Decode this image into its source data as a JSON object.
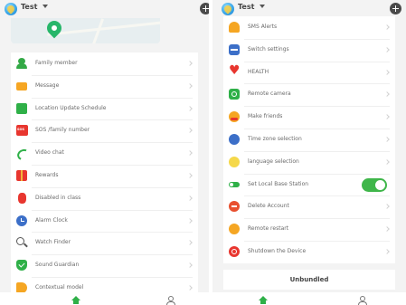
{
  "left": {
    "header": {
      "title": "Test",
      "logo_icon": "app-logo-icon",
      "add_icon": "add-circle-icon"
    },
    "map": {
      "marker_icon": "location-pin-icon"
    },
    "items": [
      {
        "label": "Family member",
        "icon": "person-icon"
      },
      {
        "label": "Message",
        "icon": "mail-icon"
      },
      {
        "label": "Location Update Schedule",
        "icon": "location-schedule-icon"
      },
      {
        "label": "SOS /family number",
        "icon": "sos-icon"
      },
      {
        "label": "Video chat",
        "icon": "phone-icon"
      },
      {
        "label": "Rewards",
        "icon": "gift-icon"
      },
      {
        "label": "Disabled in class",
        "icon": "disabled-icon"
      },
      {
        "label": "Alarm Clock",
        "icon": "alarm-clock-icon"
      },
      {
        "label": "Watch Finder",
        "icon": "search-icon"
      },
      {
        "label": "Sound Guardian",
        "icon": "shield-icon"
      },
      {
        "label": "Contextual model",
        "icon": "megaphone-icon"
      }
    ]
  },
  "right": {
    "header": {
      "title": "Test",
      "logo_icon": "app-logo-icon",
      "add_icon": "add-circle-icon"
    },
    "items": [
      {
        "label": "SMS Alerts",
        "icon": "bell-icon"
      },
      {
        "label": "Switch settings",
        "icon": "switch-icon"
      },
      {
        "label": "HEALTH",
        "icon": "heart-icon"
      },
      {
        "label": "Remote camera",
        "icon": "camera-icon"
      },
      {
        "label": "Make friends",
        "icon": "friends-icon"
      },
      {
        "label": "Time zone selection",
        "icon": "timezone-icon"
      },
      {
        "label": "language selection",
        "icon": "language-icon"
      },
      {
        "label": "Set Local Base Station",
        "icon": "station-icon",
        "toggle": true
      },
      {
        "label": "Delete Account",
        "icon": "delete-icon"
      },
      {
        "label": "Remote restart",
        "icon": "restart-icon"
      },
      {
        "label": "Shutdown the Device",
        "icon": "power-icon"
      }
    ],
    "unbundle_label": "Unbundled"
  },
  "tabbar": {
    "home_icon": "home-icon",
    "profile_icon": "profile-icon"
  },
  "colors": {
    "accent": "#3fb64a",
    "background": "#f3f3f3",
    "danger": "#e8362f"
  }
}
